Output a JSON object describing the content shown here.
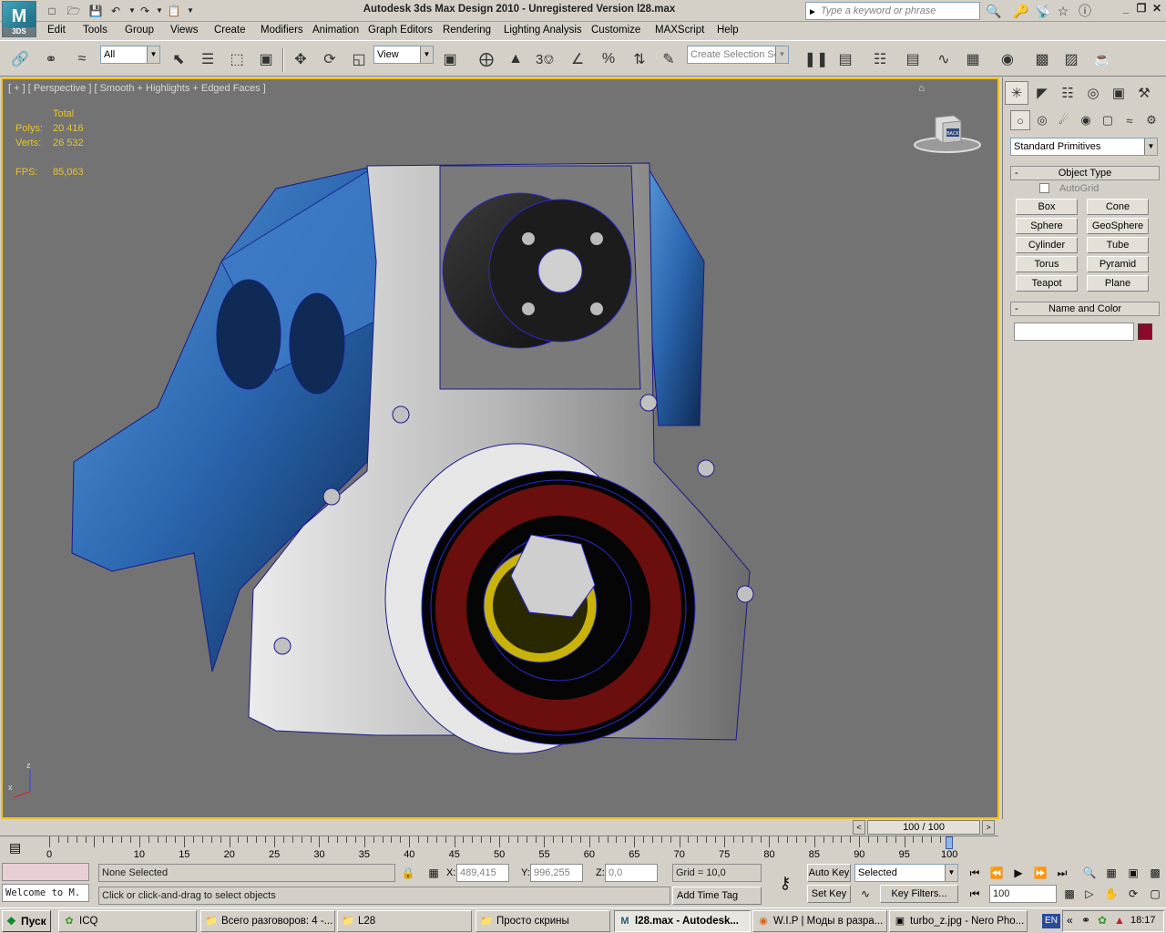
{
  "titlebar": {
    "app_logo": "3DS",
    "title": "Autodesk 3ds Max Design 2010   -   Unregistered Version      l28.max",
    "search_placeholder": "Type a keyword or phrase"
  },
  "menu": [
    "Edit",
    "Tools",
    "Group",
    "Views",
    "Create",
    "Modifiers",
    "Animation",
    "Graph Editors",
    "Rendering",
    "Lighting Analysis",
    "Customize",
    "MAXScript",
    "Help"
  ],
  "toolbar": {
    "selection_filter": "All",
    "ref_coord": "View",
    "snap_value": "3",
    "selection_set_placeholder": "Create Selection Se"
  },
  "viewport": {
    "label": "[ + ] [ Perspective ] [ Smooth + Highlights + Edged Faces ]",
    "stats_header": "Total",
    "polys_label": "Polys:",
    "polys_value": "20 416",
    "verts_label": "Verts:",
    "verts_value": "26 532",
    "fps_label": "FPS:",
    "fps_value": "85,063",
    "viewcube_face": "BACK",
    "axis_z": "z",
    "axis_x": "x"
  },
  "command_panel": {
    "category": "Standard Primitives",
    "object_type_title": "Object Type",
    "autogrid_label": "AutoGrid",
    "primitives": [
      "Box",
      "Cone",
      "Sphere",
      "GeoSphere",
      "Cylinder",
      "Tube",
      "Torus",
      "Pyramid",
      "Teapot",
      "Plane"
    ],
    "name_color_title": "Name and Color",
    "object_name": "",
    "object_color": "#8b0a2a"
  },
  "timeline": {
    "frame_display": "100 / 100",
    "ticks": [
      "0",
      "10",
      "15",
      "20",
      "25",
      "30",
      "35",
      "40",
      "45",
      "50",
      "55",
      "60",
      "65",
      "70",
      "75",
      "80",
      "85",
      "90",
      "95",
      "100"
    ]
  },
  "status": {
    "maxscript_text": "Welcome to M.",
    "selection_text": "None Selected",
    "prompt_text": "Click or click-and-drag to select objects",
    "x_label": "X:",
    "x_value": "489,415",
    "y_label": "Y:",
    "y_value": "996,255",
    "z_label": "Z:",
    "z_value": "0,0",
    "grid_text": "Grid = 10,0",
    "add_time_tag": "Add Time Tag",
    "auto_key": "Auto Key",
    "set_key": "Set Key",
    "key_mode": "Selected",
    "key_filters": "Key Filters...",
    "current_frame": "100"
  },
  "taskbar": {
    "start_label": "Пуск",
    "tasks": [
      "ICQ",
      "Всего разговоров: 4 -...",
      "L28",
      "Просто скрины",
      "l28.max - Autodesk...",
      "W.I.P | Моды в разра...",
      "turbo_z.jpg - Nero Pho..."
    ],
    "lang": "EN",
    "clock": "18:17"
  }
}
